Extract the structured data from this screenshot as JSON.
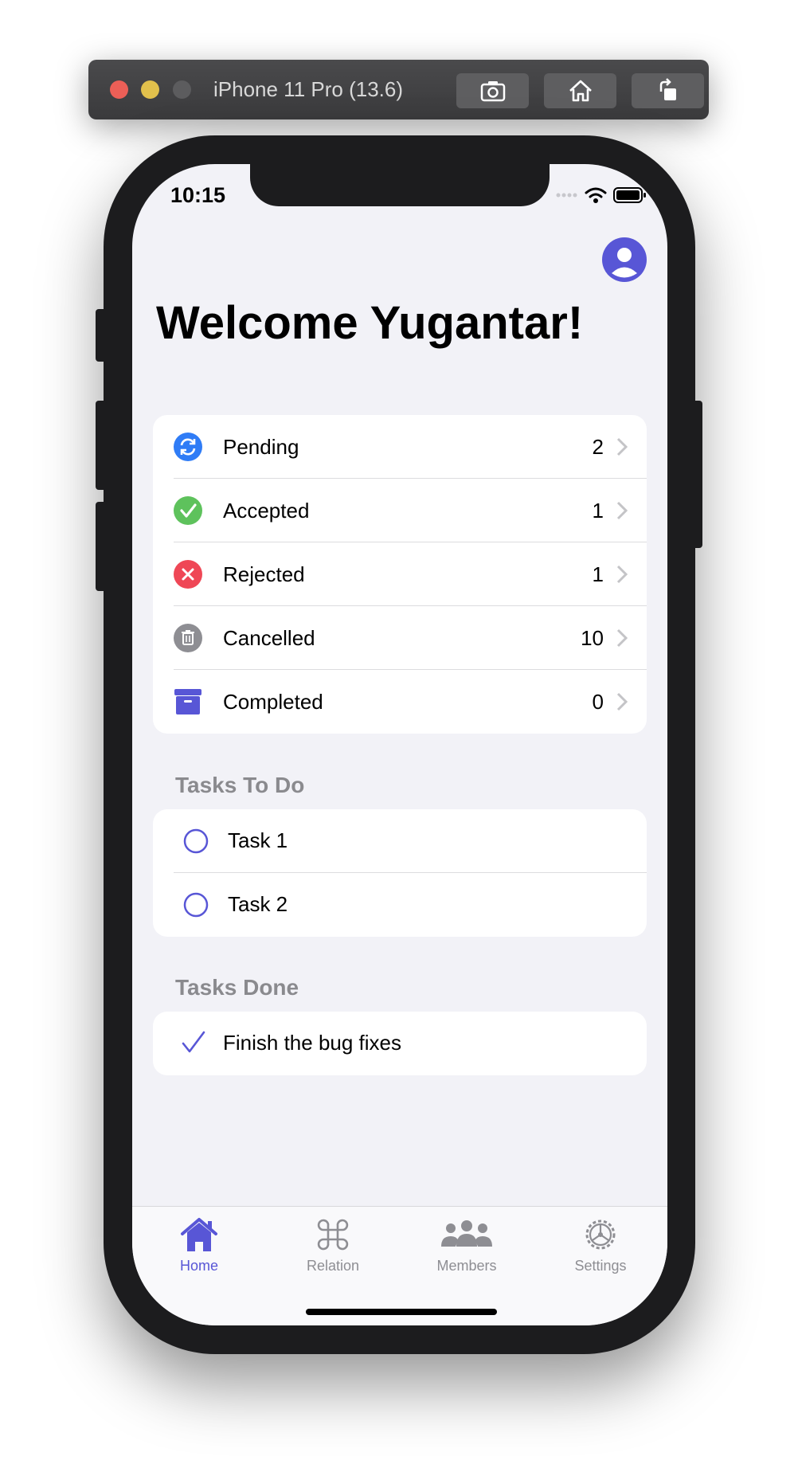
{
  "simulator": {
    "title": "iPhone 11 Pro (13.6)",
    "buttons": [
      "screenshot-icon",
      "home-icon",
      "rotate-icon"
    ]
  },
  "status_bar": {
    "time": "10:15"
  },
  "header": {
    "welcome": "Welcome Yugantar!"
  },
  "status_list": [
    {
      "label": "Pending",
      "count": "2",
      "icon": "pending-icon",
      "color": "#2f7cf6"
    },
    {
      "label": "Accepted",
      "count": "1",
      "icon": "accepted-icon",
      "color": "#5ec25c"
    },
    {
      "label": "Rejected",
      "count": "1",
      "icon": "rejected-icon",
      "color": "#ef4756"
    },
    {
      "label": "Cancelled",
      "count": "10",
      "icon": "trash-icon",
      "color": "#8e8e93"
    },
    {
      "label": "Completed",
      "count": "0",
      "icon": "archive-icon",
      "color": "#5856d6"
    }
  ],
  "tasks_todo": {
    "header": "Tasks To Do",
    "items": [
      "Task 1",
      "Task 2"
    ]
  },
  "tasks_done": {
    "header": "Tasks Done",
    "items": [
      "Finish the bug fixes"
    ]
  },
  "tabbar": {
    "tabs": [
      {
        "label": "Home",
        "icon": "house-icon",
        "active": true
      },
      {
        "label": "Relation",
        "icon": "command-icon",
        "active": false
      },
      {
        "label": "Members",
        "icon": "people-icon",
        "active": false
      },
      {
        "label": "Settings",
        "icon": "gear-icon",
        "active": false
      }
    ]
  },
  "colors": {
    "accent": "#5856d6",
    "background": "#f2f2f7"
  }
}
